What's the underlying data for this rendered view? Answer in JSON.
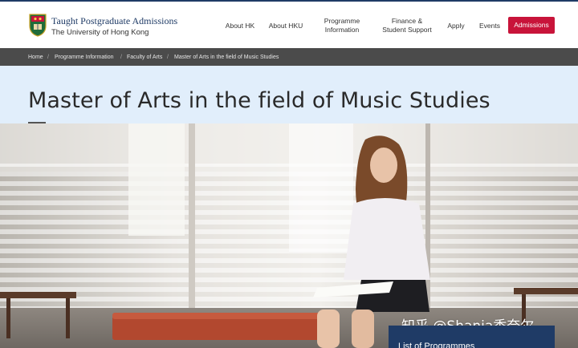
{
  "header": {
    "title": "Taught Postgraduate Admissions",
    "subtitle": "The University of Hong Kong",
    "nav": [
      {
        "label_1": "About HK",
        "label_2": ""
      },
      {
        "label_1": "About HKU",
        "label_2": ""
      },
      {
        "label_1": "Programme",
        "label_2": "Information"
      },
      {
        "label_1": "Finance &",
        "label_2": "Student Support"
      },
      {
        "label_1": "Apply",
        "label_2": ""
      },
      {
        "label_1": "Events",
        "label_2": ""
      }
    ],
    "admissions_label": "Admissions",
    "colors": {
      "brand": "#1f3b66",
      "accent": "#c8143a"
    }
  },
  "breadcrumb": {
    "items": [
      "Home",
      "Programme Information",
      "Faculty of Arts",
      "Master of Arts in the field of Music Studies"
    ],
    "separator": "/"
  },
  "main": {
    "page_title": "Master of Arts in the field of Music Studies",
    "list_box_label": "List of Programmes"
  },
  "watermark": "知乎 @Shania香奈尔"
}
